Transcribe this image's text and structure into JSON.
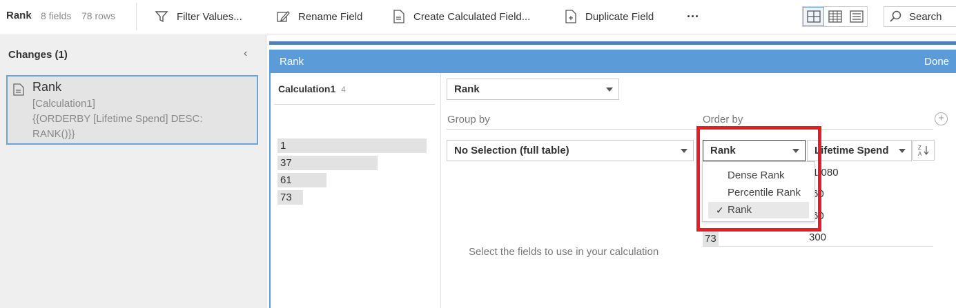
{
  "toolbar": {
    "title": "Rank",
    "fields": "8 fields",
    "rows": "78 rows",
    "filter_label": "Filter Values...",
    "rename_label": "Rename Field",
    "create_calc_label": "Create Calculated Field...",
    "duplicate_label": "Duplicate Field",
    "more_label": "···",
    "search_label": "Search"
  },
  "changes": {
    "title": "Changes (1)",
    "collapse_glyph": "‹",
    "item": {
      "name": "Rank",
      "detail_line1": "[Calculation1]",
      "detail_line2": "{{ORDERBY [Lifetime Spend] DESC:",
      "detail_line3": "RANK()}}"
    }
  },
  "editor": {
    "title": "Rank",
    "done_label": "Done",
    "calc_field": {
      "name": "Calculation1",
      "count": "4",
      "values": [
        "1",
        "37",
        "61",
        "73"
      ],
      "bar_fraction": [
        1.0,
        0.67,
        0.33,
        0.17
      ]
    },
    "function_select": "Rank",
    "group_by": {
      "label": "Group by",
      "selected": "No Selection (full table)"
    },
    "order_by": {
      "label": "Order by",
      "rank_select": "Rank",
      "field_select": "Lifetime Spend",
      "rows": [
        {
          "rank": "",
          "value": "1,080"
        },
        {
          "rank": "",
          "value": "60"
        },
        {
          "rank": "",
          "value": "60"
        },
        {
          "rank": "73",
          "value": "300"
        }
      ]
    },
    "hint": "Select the fields to use in your calculation",
    "rank_menu": {
      "options": [
        "Dense Rank",
        "Percentile Rank",
        "Rank"
      ],
      "selected": "Rank",
      "check_glyph": "✓"
    }
  },
  "colors": {
    "header_blue": "#5a9bd8",
    "stripe_blue": "#4e81b6",
    "highlight_red": "#e31e24",
    "selected_border": "#6ea2d5"
  }
}
